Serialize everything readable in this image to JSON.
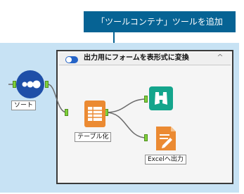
{
  "callout": {
    "text": "「ツールコンテナ」ツールを追加"
  },
  "container": {
    "title": "出力用にフォームを表形式に変換",
    "collapse_symbol": "^"
  },
  "tools": {
    "sort": {
      "label": "ソート"
    },
    "table": {
      "label": "テーブル化"
    },
    "excel_output": {
      "label": "Excelへ出力"
    },
    "browse": {
      "label": ""
    }
  },
  "colors": {
    "callout_bg": "#066394",
    "canvas_bg": "#c7e2f4",
    "sort_icon": "#1f4fa8",
    "table_icon": "#eb8a32",
    "browse_icon": "#14a58c",
    "output_icon": "#eb8a32",
    "anchor": "#7fd03a"
  },
  "icons": {
    "sort": "sort-icon",
    "table": "table-icon",
    "browse": "binoculars-icon",
    "output": "document-pen-icon",
    "toggle": "toggle-icon",
    "collapse": "chevron-up-icon"
  }
}
